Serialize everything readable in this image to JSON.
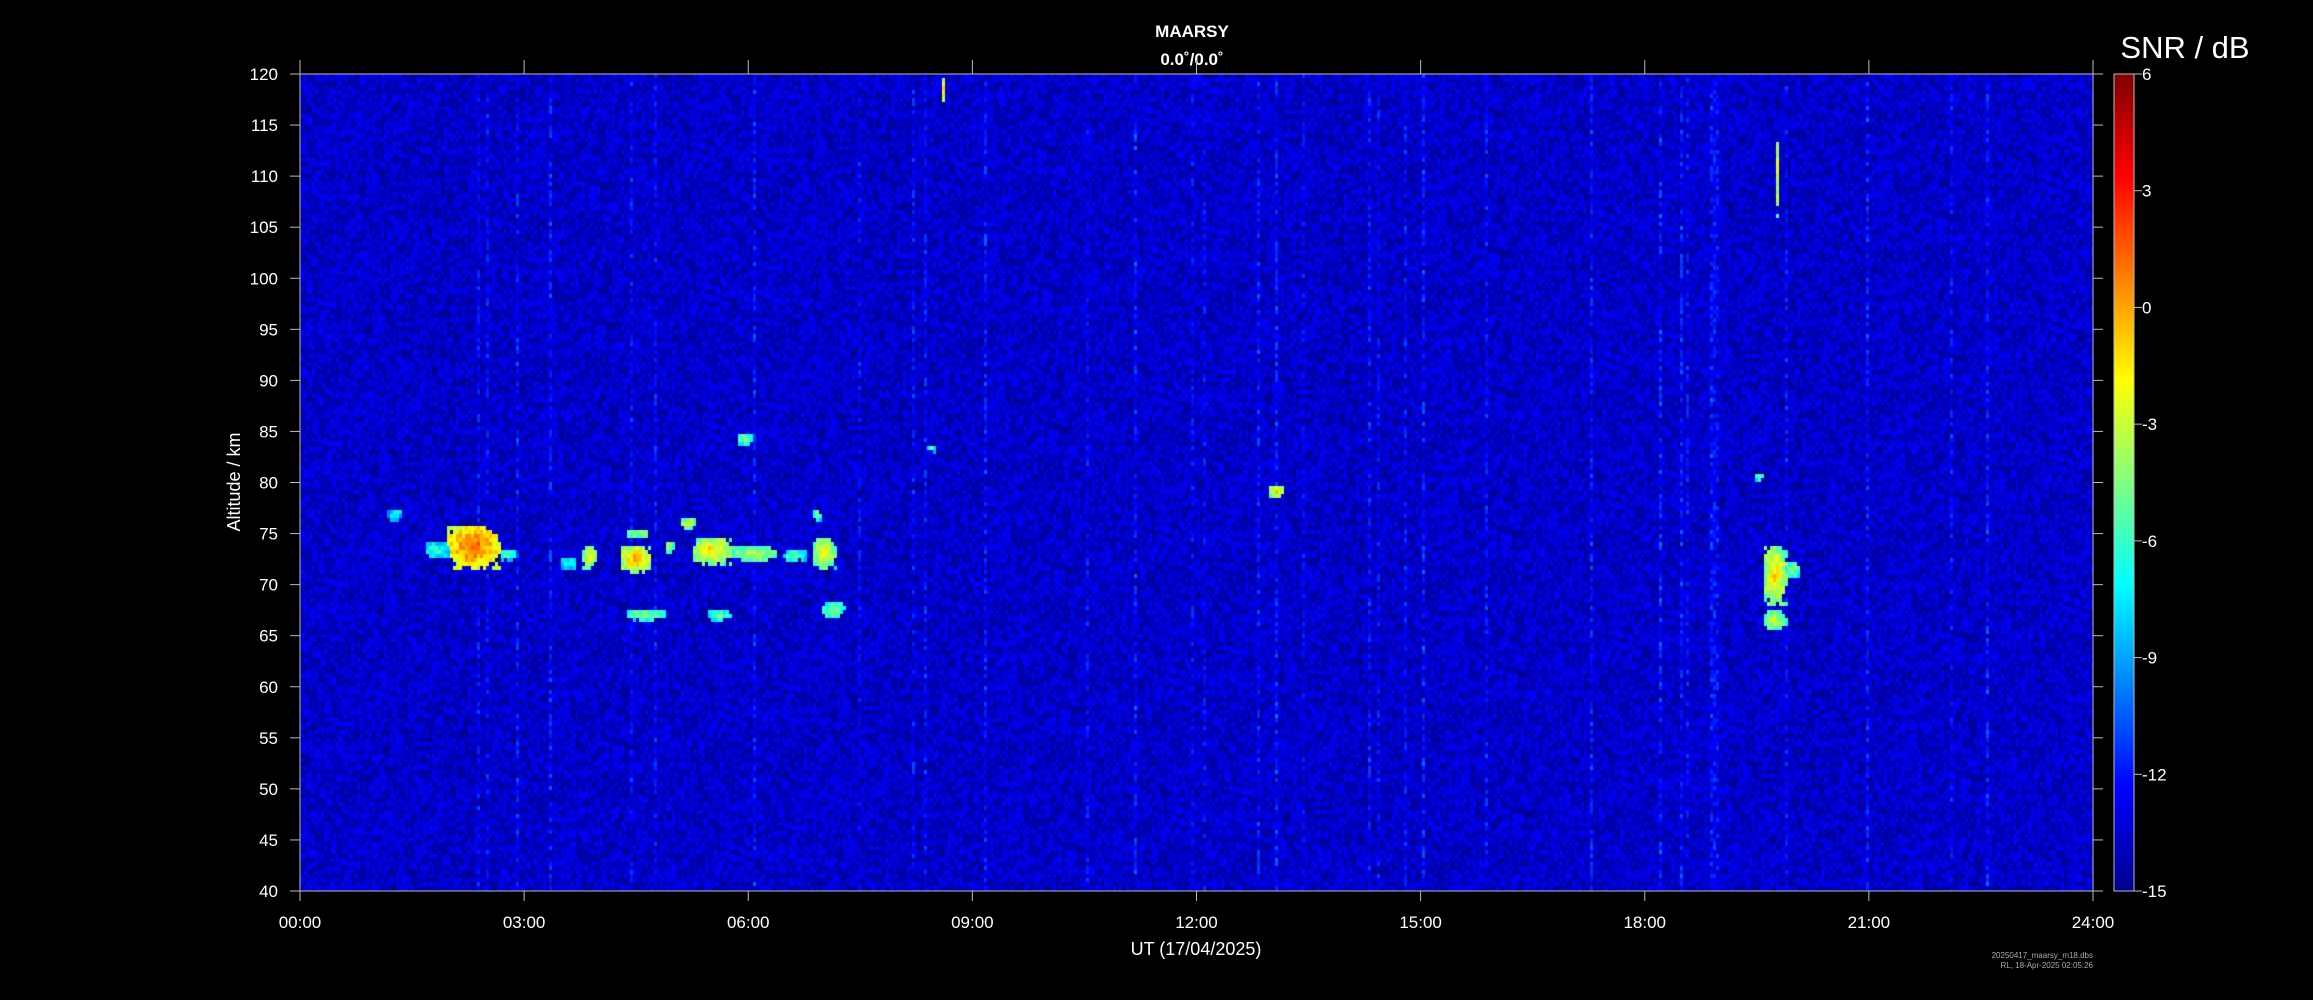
{
  "chart_data": {
    "type": "heatmap",
    "title": "MAARSY",
    "subtitle": "0.0˚/0.0˚",
    "xlabel": "UT (17/04/2025)",
    "ylabel": "Altitude / km",
    "x_tick_labels": [
      "00:00",
      "03:00",
      "06:00",
      "09:00",
      "12:00",
      "15:00",
      "18:00",
      "21:00",
      "24:00"
    ],
    "x_range_hours": [
      0,
      24
    ],
    "y_ticks": [
      40,
      45,
      50,
      55,
      60,
      65,
      70,
      75,
      80,
      85,
      90,
      95,
      100,
      105,
      110,
      115,
      120
    ],
    "ylim": [
      40,
      120
    ],
    "colorbar": {
      "title": "SNR / dB",
      "ticks": [
        6,
        3,
        0,
        -3,
        -6,
        -9,
        -12,
        -15
      ],
      "range": [
        -15,
        6
      ],
      "colormap": "jet"
    },
    "background_snr": -13.5,
    "echoes": [
      {
        "t0": 2.0,
        "t1": 2.7,
        "alt0": 71.5,
        "alt1": 75.5,
        "snr": 2
      },
      {
        "t0": 1.7,
        "t1": 2.0,
        "alt0": 72.5,
        "alt1": 74.0,
        "snr": -6
      },
      {
        "t0": 2.7,
        "t1": 2.9,
        "alt0": 72.2,
        "alt1": 73.0,
        "snr": -5
      },
      {
        "t0": 1.2,
        "t1": 1.4,
        "alt0": 76.0,
        "alt1": 77.0,
        "snr": -7
      },
      {
        "t0": 3.5,
        "t1": 3.7,
        "alt0": 71.5,
        "alt1": 72.5,
        "snr": -6
      },
      {
        "t0": 3.8,
        "t1": 4.0,
        "alt0": 71.5,
        "alt1": 73.5,
        "snr": -2
      },
      {
        "t0": 4.3,
        "t1": 4.7,
        "alt0": 71.0,
        "alt1": 73.5,
        "snr": 0
      },
      {
        "t0": 4.4,
        "t1": 4.7,
        "alt0": 74.5,
        "alt1": 75.2,
        "snr": -3
      },
      {
        "t0": 4.9,
        "t1": 5.0,
        "alt0": 73.0,
        "alt1": 74.0,
        "snr": -3
      },
      {
        "t0": 5.1,
        "t1": 5.3,
        "alt0": 75.5,
        "alt1": 76.5,
        "snr": -2
      },
      {
        "t0": 5.3,
        "t1": 5.8,
        "alt0": 72.0,
        "alt1": 74.5,
        "snr": -1
      },
      {
        "t0": 5.8,
        "t1": 6.4,
        "alt0": 72.0,
        "alt1": 73.5,
        "snr": -3
      },
      {
        "t0": 6.5,
        "t1": 6.8,
        "alt0": 72.0,
        "alt1": 73.0,
        "snr": -5
      },
      {
        "t0": 6.9,
        "t1": 7.2,
        "alt0": 71.5,
        "alt1": 74.5,
        "snr": -2
      },
      {
        "t0": 6.9,
        "t1": 7.0,
        "alt0": 76.0,
        "alt1": 77.0,
        "snr": -4
      },
      {
        "t0": 5.9,
        "t1": 6.1,
        "alt0": 83.5,
        "alt1": 84.5,
        "snr": -4
      },
      {
        "t0": 4.4,
        "t1": 4.9,
        "alt0": 66.5,
        "alt1": 67.5,
        "snr": -4
      },
      {
        "t0": 5.5,
        "t1": 5.8,
        "alt0": 66.5,
        "alt1": 67.5,
        "snr": -5
      },
      {
        "t0": 7.0,
        "t1": 7.3,
        "alt0": 66.5,
        "alt1": 68.0,
        "snr": -4
      },
      {
        "t0": 8.4,
        "t1": 8.5,
        "alt0": 82.7,
        "alt1": 83.2,
        "snr": -5
      },
      {
        "t0": 13.0,
        "t1": 13.2,
        "alt0": 78.5,
        "alt1": 79.5,
        "snr": -1
      },
      {
        "t0": 19.6,
        "t1": 19.9,
        "alt0": 68.0,
        "alt1": 73.5,
        "snr": -1
      },
      {
        "t0": 19.9,
        "t1": 20.1,
        "alt0": 70.5,
        "alt1": 72.0,
        "snr": -4
      },
      {
        "t0": 19.6,
        "t1": 19.9,
        "alt0": 65.5,
        "alt1": 67.5,
        "snr": -3
      },
      {
        "t0": 19.5,
        "t1": 19.6,
        "alt0": 80.0,
        "alt1": 80.7,
        "snr": -5
      },
      {
        "t0": 8.6,
        "t1": 8.62,
        "alt0": 117,
        "alt1": 120,
        "snr": 1
      },
      {
        "t0": 19.77,
        "t1": 19.79,
        "alt0": 106,
        "alt1": 114,
        "snr": 0
      }
    ],
    "footer_lines": [
      "20250417_maarsy_m18.dbs",
      "RL, 18-Apr-2025 02:05:26"
    ]
  }
}
